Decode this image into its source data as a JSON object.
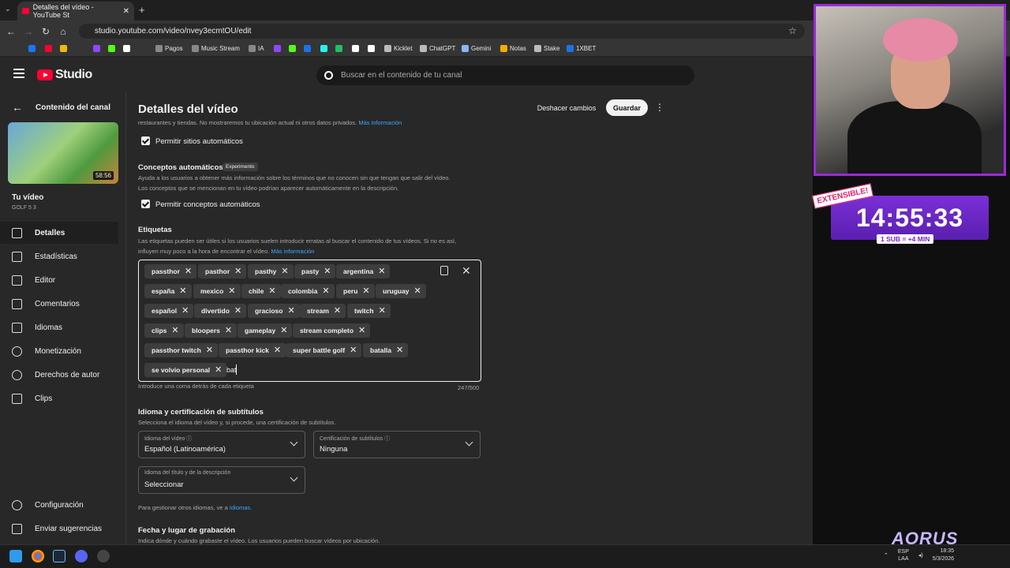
{
  "browser": {
    "tab_title": "Detalles del vídeo - YouTube St",
    "tab_close": "✕",
    "new_tab": "+",
    "tab_menu": "⌄",
    "url": "studio.youtube.com/video/nvey3ecmtOU/edit",
    "bookmarks": [
      {
        "label": "",
        "color": "#1877f2"
      },
      {
        "label": "",
        "color": "#ff0033"
      },
      {
        "label": "",
        "color": "#f0b90b"
      },
      {
        "label": "",
        "color": "#9146ff"
      },
      {
        "label": "",
        "color": "#53fc18"
      },
      {
        "label": "",
        "color": "#ffffff"
      },
      {
        "label": "Pagos",
        "color": "#888888"
      },
      {
        "label": "Music Stream",
        "color": "#888888"
      },
      {
        "label": "IA",
        "color": "#888888"
      },
      {
        "label": "",
        "color": "#9146ff"
      },
      {
        "label": "",
        "color": "#53fc18"
      },
      {
        "label": "",
        "color": "#1a73e8"
      },
      {
        "label": "",
        "color": "#25f4ee"
      },
      {
        "label": "",
        "color": "#21c063"
      },
      {
        "label": "",
        "color": "#ffffff"
      },
      {
        "label": "",
        "color": "#ffffff"
      },
      {
        "label": "Kicklet",
        "color": "#bbbbbb"
      },
      {
        "label": "ChatGPT",
        "color": "#bbbbbb"
      },
      {
        "label": "Gemini",
        "color": "#8ab4f8"
      },
      {
        "label": "Notas",
        "color": "#f9ab00"
      },
      {
        "label": "Stake",
        "color": "#bbbbbb"
      },
      {
        "label": "1XBET",
        "color": "#1a73e8"
      }
    ]
  },
  "studio": {
    "logo": "Studio",
    "search_placeholder": "Buscar en el contenido de tu canal"
  },
  "sidebar": {
    "back_label": "Contenido del canal",
    "thumb_duration": "58:56",
    "your_video": "Tu vídeo",
    "video_name": "GOLF 5 3",
    "items": [
      {
        "label": "Detalles",
        "active": true
      },
      {
        "label": "Estadísticas",
        "active": false
      },
      {
        "label": "Editor",
        "active": false
      },
      {
        "label": "Comentarios",
        "active": false
      },
      {
        "label": "Idiomas",
        "active": false
      },
      {
        "label": "Monetización",
        "active": false
      },
      {
        "label": "Derechos de autor",
        "active": false
      },
      {
        "label": "Clips",
        "active": false
      }
    ],
    "settings": "Configuración",
    "feedback": "Enviar sugerencias"
  },
  "main": {
    "title": "Detalles del vídeo",
    "undo": "Deshacer cambios",
    "save": "Guardar",
    "cut_text": "restaurantes y tiendas. No mostraremos tu ubicación actual ni otros datos privados.",
    "cut_link": "Más información",
    "allow_places": "Permitir sitios automáticos",
    "concepts_title": "Conceptos automáticos",
    "concepts_badge": "Experimento",
    "concepts_desc1": "Ayuda a los usuarios a obtener más información sobre los términos que no conocen sin que tengan que salir del vídeo.",
    "concepts_desc2": "Los conceptos que se mencionan en tu vídeo podrían aparecer automáticamente en la descripción.",
    "allow_concepts": "Permitir conceptos automáticos",
    "tags_title": "Etiquetas",
    "tags_desc1": "Las etiquetas pueden ser útiles si los usuarios suelen introducir erratas al buscar el contenido de tus vídeos. Si no es así,",
    "tags_desc2": "influyen muy poco a la hora de encontrar el vídeo.",
    "tags_link": "Más información",
    "tags": [
      "passthor",
      "pasthor",
      "pasthy",
      "pasty",
      "argentina",
      "españa",
      "mexico",
      "chile",
      "colombia",
      "peru",
      "uruguay",
      "español",
      "divertido",
      "gracioso",
      "stream",
      "twitch",
      "clips",
      "bloopers",
      "gameplay",
      "stream completo",
      "passthor twitch",
      "passthor kick",
      "super battle golf",
      "batalla",
      "se volvio personal"
    ],
    "tag_remove": "✕",
    "typing": "bat",
    "tags_hint": "Introduce una coma detrás de cada etiqueta",
    "tags_count": "247/500",
    "subs_title": "Idioma y certificación de subtítulos",
    "subs_desc": "Selecciona el idioma del vídeo y, si procede, una certificación de subtítulos.",
    "video_lang_cap": "Idioma del vídeo ⓘ",
    "video_lang_val": "Español (Latinoamérica)",
    "cert_cap": "Certificación de subtítulos ⓘ",
    "cert_val": "Ninguna",
    "title_lang_cap": "Idioma del título y de la descripción",
    "title_lang_val": "Seleccionar",
    "manage_text": "Para gestionar otros idiomas, ve a",
    "manage_link": "Idiomas.",
    "date_title": "Fecha y lugar de grabación",
    "date_desc": "Indica dónde y cuándo grabaste el vídeo. Los usuarios pueden buscar vídeos por ubicación."
  },
  "overlay": {
    "extensible": "EXTENSIBLE!",
    "timer": "14:55:33",
    "sub_rate": "1 SUB = +4 MIN",
    "brand": "AORUS"
  },
  "taskbar": {
    "lang1": "ESP",
    "lang2": "LAA",
    "time": "18:35",
    "date": "5/3/2026"
  }
}
